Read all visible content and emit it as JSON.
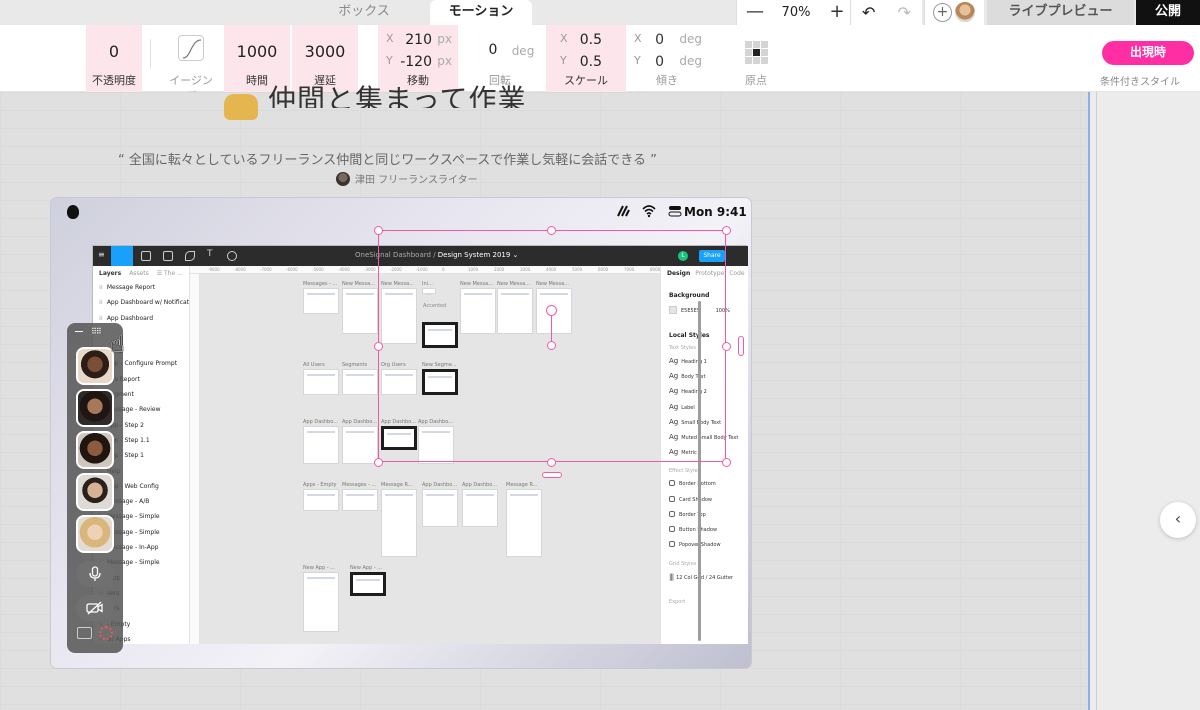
{
  "tabs": {
    "box": "ボックス",
    "motion": "モーション"
  },
  "zoom": {
    "minus": "—",
    "value": "70%",
    "plus": "+"
  },
  "history": {
    "undo": "↶",
    "redo": "↷"
  },
  "collab": {
    "add": "+"
  },
  "header": {
    "live_preview": "ライブプレビュー",
    "publish": "公開"
  },
  "motion": {
    "opacity": {
      "value": "0",
      "label": "不透明度"
    },
    "easing": {
      "label": "イージング"
    },
    "duration": {
      "value": "1000",
      "label": "時間"
    },
    "delay": {
      "value": "3000",
      "label": "遅延"
    },
    "move": {
      "x_axis": "X",
      "x": "210",
      "y_axis": "Y",
      "y": "-120",
      "unit": "px",
      "label": "移動"
    },
    "rotate": {
      "value": "0",
      "unit": "deg",
      "label": "回転"
    },
    "scale": {
      "x_axis": "X",
      "x": "0.5",
      "y_axis": "Y",
      "y": "0.5",
      "label": "スケール"
    },
    "skew": {
      "x_axis": "X",
      "x": "0",
      "y_axis": "Y",
      "y": "0",
      "unit": "deg",
      "label": "傾き"
    },
    "origin": {
      "label": "原点"
    },
    "trigger": {
      "label": "出現時"
    },
    "conditional": {
      "label": "条件付きスタイル"
    }
  },
  "page": {
    "heading": "仲間と集まって作業",
    "quote": "“ 全国に転々としているフリーランス仲間と同じワークスペースで作業し気軽に会話できる ”",
    "author": "津田 フリーランスライター"
  },
  "mac": {
    "clock": "Mon  9:41"
  },
  "figma": {
    "breadcrumb_project": "OneSignal Dashboard",
    "breadcrumb_sep": " / ",
    "breadcrumb_file": "Design System 2019 ⌄",
    "share": "Share",
    "user_initial": "L",
    "layers_tabs": {
      "layers": "Layers",
      "assets": "Assets",
      "page": "☰ The ..."
    },
    "layers": [
      "Message Report",
      "App Dashboard w/ Notificat...",
      "App Dashboard",
      "",
      "",
      "App - Configure Prompt",
      "age Report",
      "Segment",
      "Message - Review",
      "App - Step 2",
      "App - Step 1.1",
      "App - Step 1",
      "Help",
      "App - Web Config",
      "Message - A/B",
      "Message - Simple",
      "Message - Simple",
      "Message - In-App",
      "Message - Simple",
      "ents",
      "sers",
      "sers",
      "- Empty",
      "w/ Apps"
    ],
    "ruler": [
      "-9000",
      "-8000",
      "-7000",
      "-6000",
      "-5000",
      "-4000",
      "-3000",
      "-2000",
      "-1000",
      "0",
      "1000",
      "2000",
      "3000",
      "4000",
      "5000",
      "6000",
      "7000",
      "8000"
    ],
    "frame_titles": [
      "Messages - ...",
      "New Messa...",
      "New Messa...",
      "Ini...",
      "New Messa...",
      "New Messa...",
      "New Messa...",
      "All Users",
      "Segments",
      "Org Users",
      "New Segme...",
      "App Dashbo...",
      "App Dashbo...",
      "App Dashbo...",
      "App Dashbo...",
      "Apps - Empty",
      "Messages - ...",
      "Message R...",
      "App Dashbo...",
      "App Dashbo...",
      "Message R...",
      "New App - ...",
      "New App - ..."
    ],
    "accented_label": "Accented",
    "props_tabs": {
      "design": "Design",
      "prototype": "Prototype",
      "code": "Code"
    },
    "background": {
      "title": "Background",
      "hex": "E5E5E5",
      "opacity": "100%"
    },
    "local_styles": "Local Styles",
    "text_styles_title": "Text Styles",
    "text_styles": [
      "Heading 1",
      "Body Text",
      "Heading 2",
      "Label",
      "Small Body Text",
      "Muted Small Body Text",
      "Metric"
    ],
    "ag": "Ag",
    "effect_styles_title": "Effect Styles",
    "effect_styles": [
      "Border Bottom",
      "Card Shadow",
      "Border Top",
      "Button Shadow",
      "Popover Shadow"
    ],
    "grid_styles_title": "Grid Styles",
    "grid_style": "12 Col Grid / 24 Gutter",
    "export": "Export"
  },
  "icons": [
    "apple-icon",
    "wifi-icon",
    "control-center-icon",
    "microphone-icon",
    "camera-off-icon",
    "screen-share-icon",
    "record-icon",
    "hand-cursor-icon",
    "chevron-left-icon",
    "raised-hands-icon"
  ],
  "colors": {
    "accent_pink": "#ff2fa3",
    "selection": "#f25aa8",
    "figma_blue": "#18a0fb",
    "field_pink": "#fce6ec"
  },
  "nav": {
    "collapse": "‹"
  }
}
